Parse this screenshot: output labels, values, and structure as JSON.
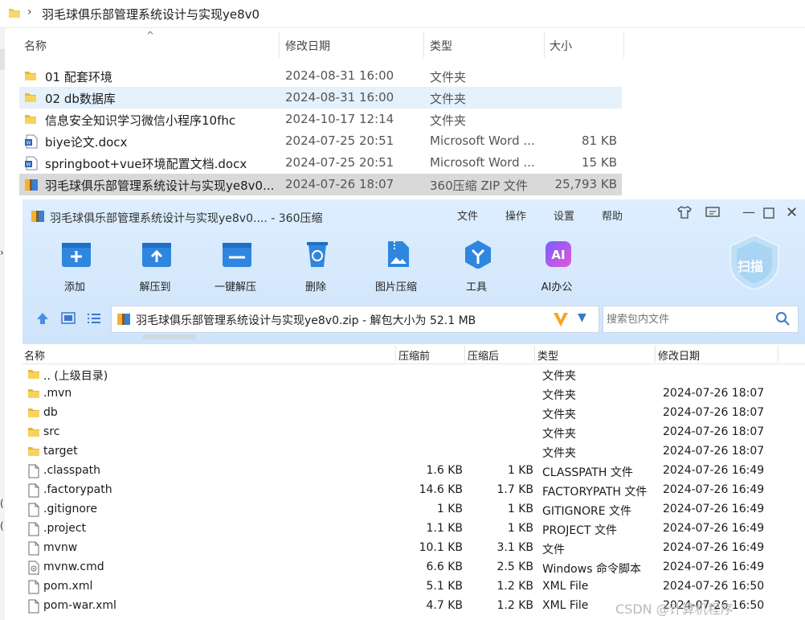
{
  "explorer": {
    "breadcrumb": "羽毛球俱乐部管理系统设计与实现ye8v0",
    "columns": {
      "name": "名称",
      "date": "修改日期",
      "type": "类型",
      "size": "大小"
    },
    "rows": [
      {
        "name": "01 配套环境",
        "date": "2024-08-31 16:00",
        "type": "文件夹",
        "size": "",
        "icon": "folder-icon"
      },
      {
        "name": "02 db数据库",
        "date": "2024-08-31 16:00",
        "type": "文件夹",
        "size": "",
        "icon": "folder-icon"
      },
      {
        "name": "信息安全知识学习微信小程序10fhc",
        "date": "2024-10-17 12:14",
        "type": "文件夹",
        "size": "",
        "icon": "folder-icon"
      },
      {
        "name": "biye论文.docx",
        "date": "2024-07-25 20:51",
        "type": "Microsoft Word ...",
        "size": "81 KB",
        "icon": "word-doc-icon"
      },
      {
        "name": "springboot+vue环境配置文档.docx",
        "date": "2024-07-25 20:51",
        "type": "Microsoft Word ...",
        "size": "15 KB",
        "icon": "word-doc-icon"
      },
      {
        "name": "羽毛球俱乐部管理系统设计与实现ye8v0...",
        "date": "2024-07-26 18:07",
        "type": "360压缩 ZIP 文件",
        "size": "25,793 KB",
        "icon": "zip-archive-icon"
      }
    ]
  },
  "zip": {
    "title": "羽毛球俱乐部管理系统设计与实现ye8v0.... - 360压缩",
    "menu": [
      "文件",
      "操作",
      "设置",
      "帮助"
    ],
    "tools": [
      "添加",
      "解压到",
      "一键解压",
      "删除",
      "图片压缩",
      "工具",
      "AI办公"
    ],
    "scan_label": "扫描",
    "path_text": "羽毛球俱乐部管理系统设计与实现ye8v0.zip - 解包大小为 52.1 MB",
    "search_placeholder": "搜索包内文件",
    "columns": {
      "name": "名称",
      "before": "压缩前",
      "after": "压缩后",
      "type": "类型",
      "date": "修改日期"
    },
    "rows": [
      {
        "name": ".. (上级目录)",
        "before": "",
        "after": "",
        "type": "文件夹",
        "date": "",
        "icon": "folder-icon"
      },
      {
        "name": ".mvn",
        "before": "",
        "after": "",
        "type": "文件夹",
        "date": "2024-07-26 18:07",
        "icon": "folder-icon"
      },
      {
        "name": "db",
        "before": "",
        "after": "",
        "type": "文件夹",
        "date": "2024-07-26 18:07",
        "icon": "folder-icon"
      },
      {
        "name": "src",
        "before": "",
        "after": "",
        "type": "文件夹",
        "date": "2024-07-26 18:07",
        "icon": "folder-icon"
      },
      {
        "name": "target",
        "before": "",
        "after": "",
        "type": "文件夹",
        "date": "2024-07-26 18:07",
        "icon": "folder-icon"
      },
      {
        "name": ".classpath",
        "before": "1.6 KB",
        "after": "1 KB",
        "type": "CLASSPATH 文件",
        "date": "2024-07-26 16:49",
        "icon": "file-icon"
      },
      {
        "name": ".factorypath",
        "before": "14.6 KB",
        "after": "1.7 KB",
        "type": "FACTORYPATH 文件",
        "date": "2024-07-26 16:49",
        "icon": "file-icon"
      },
      {
        "name": ".gitignore",
        "before": "1 KB",
        "after": "1 KB",
        "type": "GITIGNORE 文件",
        "date": "2024-07-26 16:49",
        "icon": "file-icon"
      },
      {
        "name": ".project",
        "before": "1.1 KB",
        "after": "1 KB",
        "type": "PROJECT 文件",
        "date": "2024-07-26 16:49",
        "icon": "file-icon"
      },
      {
        "name": "mvnw",
        "before": "10.1 KB",
        "after": "3.1 KB",
        "type": "文件",
        "date": "2024-07-26 16:49",
        "icon": "file-icon"
      },
      {
        "name": "mvnw.cmd",
        "before": "6.6 KB",
        "after": "2.5 KB",
        "type": "Windows 命令脚本",
        "date": "2024-07-26 16:49",
        "icon": "cmd-script-icon"
      },
      {
        "name": "pom.xml",
        "before": "5.1 KB",
        "after": "1.2 KB",
        "type": "XML File",
        "date": "2024-07-26 16:50",
        "icon": "file-icon"
      },
      {
        "name": "pom-war.xml",
        "before": "4.7 KB",
        "after": "1.2 KB",
        "type": "XML File",
        "date": "2024-07-26 16:50",
        "icon": "file-icon"
      }
    ]
  },
  "watermark": "CSDN @计算机程序"
}
